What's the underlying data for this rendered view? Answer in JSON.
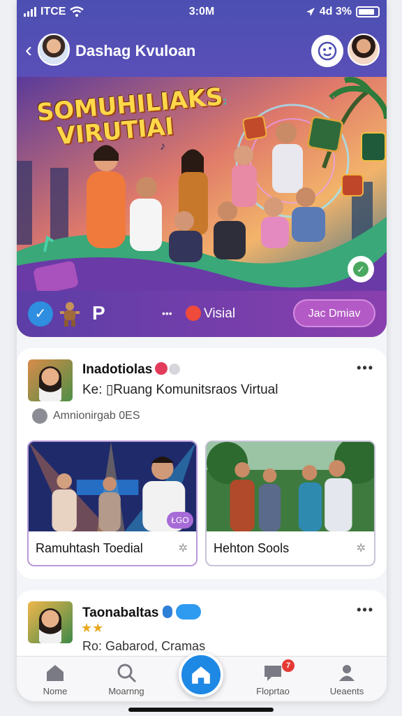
{
  "status_bar": {
    "carrier": "ITCE",
    "time": "3:0M",
    "battery": "4d 3%"
  },
  "header": {
    "title": "Dashag Kvuloan"
  },
  "hero": {
    "title_line1": "SOMUHILIAKS",
    "title_line2": "VIRUTIAI",
    "visial_label": "Visial",
    "join_label": "Jac Dmiav",
    "p_label": "P"
  },
  "post1": {
    "name": "Inadotiolas",
    "subtitle": "Ke: ▯Ruang Komunitsraos Virtual",
    "meta": "Amnionirgab 0ES",
    "tiles": [
      {
        "caption": "Ramuhtash Toedial",
        "tag": "ŁGO"
      },
      {
        "caption": "Hehton Sools"
      }
    ]
  },
  "post2": {
    "name": "Taonabaltas",
    "subtitle": "Ro: Gabarod, Cramas"
  },
  "nav": {
    "items": [
      {
        "label": "Nome"
      },
      {
        "label": "Moarnng"
      },
      {
        "label": "Floprtao",
        "badge": "7"
      },
      {
        "label": "Ueaents"
      }
    ]
  },
  "colors": {
    "brand": "#4c4fb1",
    "accent": "#1e88e5",
    "join": "#b45ac6"
  }
}
